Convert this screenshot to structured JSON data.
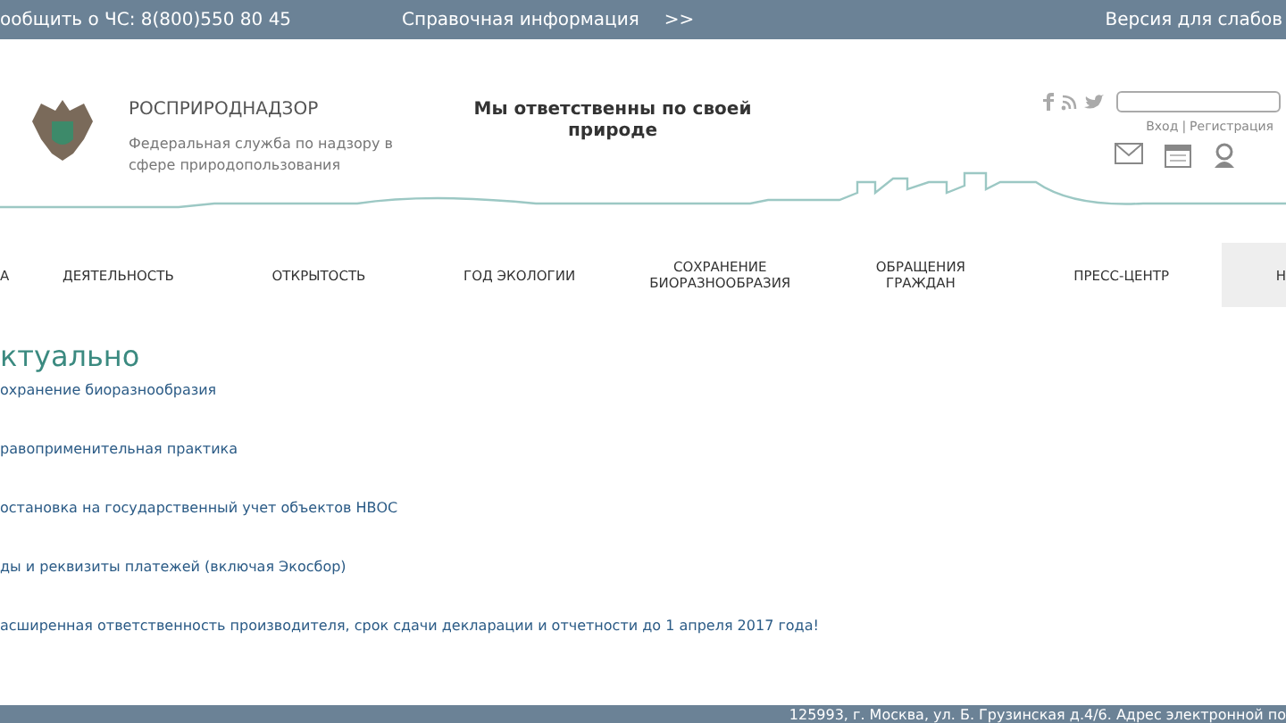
{
  "top_bar": {
    "hotline": "ообщить о ЧС: 8(800)550 80 45",
    "reference": "Справочная информация",
    "more": ">>",
    "accessibility": "Версия для слабов"
  },
  "header": {
    "org_name": "РОСПРИРОДНАДЗОР",
    "org_subtitle": "Федеральная служба по надзору в сфере природопользования",
    "slogan": "Мы ответственны по своей природе",
    "login": "Вход",
    "separator": "|",
    "register": "Регистрация"
  },
  "nav": [
    {
      "label": "А",
      "selected": false
    },
    {
      "label": "ДЕЯТЕЛЬНОСТЬ",
      "selected": false
    },
    {
      "label": "ОТКРЫТОСТЬ",
      "selected": false
    },
    {
      "label": "ГОД ЭКОЛОГИИ",
      "selected": false
    },
    {
      "label": "СОХРАНЕНИЕ БИОРАЗНООБРАЗИЯ",
      "selected": false
    },
    {
      "label": "ОБРАЩЕНИЯ ГРАЖДАН",
      "selected": false
    },
    {
      "label": "ПРЕСС-ЦЕНТР",
      "selected": false
    },
    {
      "label": "Н",
      "selected": true
    }
  ],
  "section": {
    "title": "ктуально",
    "links": [
      "охранение биоразнообразия",
      "равоприменительная практика",
      "остановка на государственный учет объектов НВОС",
      "ды и реквизиты платежей (включая Экосбор)",
      "асширенная ответственность производителя, срок сдачи декларации и отчетности до 1 апреля 2017 года!"
    ]
  },
  "footer": {
    "address": "125993, г. Москва, ул. Б. Грузинская д.4/6. Адрес электронной по"
  }
}
